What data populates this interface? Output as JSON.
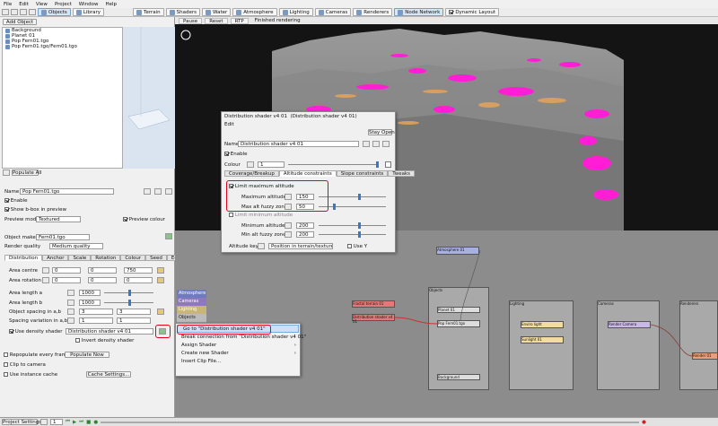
{
  "menu": [
    "File",
    "Edit",
    "View",
    "Project",
    "Window",
    "Help"
  ],
  "toolbar": {
    "add_object": "Add Object",
    "objects": "Objects",
    "library": "Library",
    "terrain": "Terrain",
    "shaders": "Shaders",
    "water": "Water",
    "atmosphere": "Atmosphere",
    "lighting": "Lighting",
    "cameras": "Cameras",
    "renderers": "Renderers",
    "node_network": "Node Network",
    "dynamic_layout": "Dynamic Layout"
  },
  "render_bar": {
    "pause": "Pause",
    "reset": "Reset",
    "rtp": "RTP",
    "status": "Finished rendering"
  },
  "tree": [
    "Background",
    "Planet 01",
    "Pop Fern01.tgo",
    "Pop Fern01.tgo/Fern01.tgo"
  ],
  "populate_all": "Populate All",
  "props": {
    "name_label": "Name",
    "name_value": "Pop Fern01.tgo",
    "enable": "Enable",
    "show_bbox": "Show b-box in preview",
    "preview_mode_label": "Preview mode",
    "preview_mode_value": "Textured",
    "preview_colour": "Preview colour",
    "object_maker_label": "Object maker",
    "object_maker_value": "Fern01.tgo",
    "render_quality_label": "Render quality",
    "render_quality_value": "Medium quality"
  },
  "tabs": [
    "Distribution",
    "Anchor",
    "Scale",
    "Rotation",
    "Colour",
    "Seed",
    "Editing"
  ],
  "dist": {
    "area_centre": "Area centre",
    "area_centre_vals": [
      "0",
      "0",
      "750"
    ],
    "area_rotation": "Area rotation",
    "area_rotation_vals": [
      "0",
      "0",
      "0"
    ],
    "area_length_a": "Area length a",
    "area_length_a_val": "1000",
    "area_length_b": "Area length b",
    "area_length_b_val": "1000",
    "object_spacing": "Object spacing in a,b",
    "object_spacing_vals": [
      "3",
      "3"
    ],
    "spacing_variation": "Spacing variation in a,b",
    "spacing_variation_vals": [
      "1",
      "1"
    ],
    "use_density": "Use density shader",
    "density_value": "Distribution shader v4 01",
    "invert_density": "Invert density shader",
    "repopulate": "Repopulate every frame",
    "populate_now": "Populate Now",
    "clip_camera": "Clip to camera",
    "use_cache": "Use instance cache",
    "cache_settings": "Cache Settings..."
  },
  "side_popup": [
    "Atmosphere",
    "Cameras",
    "Lighting",
    "Objects"
  ],
  "context_menu": [
    "Go to \"Distribution shader v4 01\"",
    "Break connection from \"Distribution shader v4 01\"",
    "Assign Shader",
    "Create new Shader",
    "Insert Clip File..."
  ],
  "dialog": {
    "title_a": "Distribution shader v4 01",
    "title_b": "(Distribution shader v4 01)",
    "edit": "Edit",
    "stay_open": "Stay Open",
    "name_label": "Name",
    "name_value": "Distribution shader v4 01",
    "enable": "Enable",
    "colour_label": "Colour",
    "colour_value": "1",
    "tabs": [
      "Coverage/Breakup",
      "Altitude constraints",
      "Slope constraints",
      "Tweaks"
    ],
    "limit_max": "Limit maximum altitude",
    "max_alt": "Maximum altitude",
    "max_alt_val": "150",
    "max_fuzzy": "Max alt fuzzy zone",
    "max_fuzzy_val": "50",
    "limit_min": "Limit minimum altitude",
    "min_alt": "Minimum altitude",
    "min_alt_val": "200",
    "min_fuzzy": "Min alt fuzzy zone",
    "min_fuzzy_val": "200",
    "alt_key_label": "Altitude key",
    "alt_key_value": "Position in terrain/texture",
    "use_y": "Use Y"
  },
  "nodes": {
    "atmosphere": "Atmosphere 01",
    "objects_group": "Objects",
    "fern": "Pop Fern01.tgo",
    "dist_shader_a": "Fractal terrain 01",
    "dist_shader_b": "Distribution shader v4 01",
    "lighting_group": "Lighting",
    "light1": "Enviro light",
    "light2": "Sunlight 01",
    "cameras_group": "Cameras",
    "render_cam": "Render Camera",
    "renderers_group": "Renderers",
    "renderer": "Render 01",
    "background": "Background",
    "planet": "Planet 01"
  },
  "status": {
    "project_settings": "Project Settings...",
    "frame": "1"
  }
}
